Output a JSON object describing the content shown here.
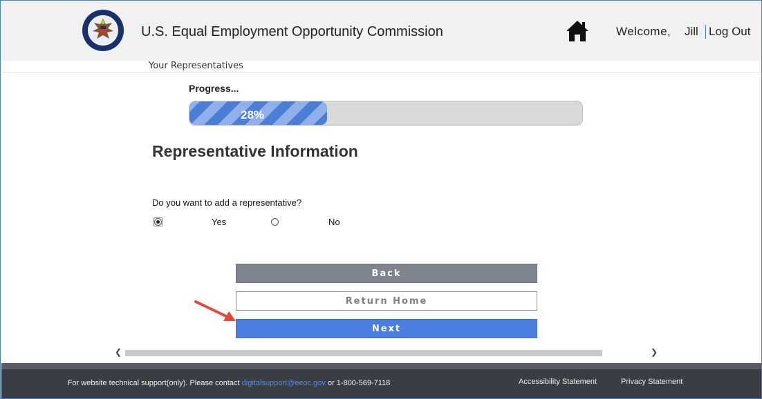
{
  "header": {
    "site_title": "U.S. Equal Employment Opportunity Commission",
    "welcome": "Welcome,",
    "user_name": "Jill",
    "logout": "Log Out"
  },
  "breadcrumb": "Your Representatives",
  "progress": {
    "label": "Progress...",
    "percent_text": "28%",
    "fraction": 0.28
  },
  "section": {
    "heading": "Representative Information",
    "question": "Do you want to add a representative?",
    "options": [
      {
        "label": "Yes",
        "checked": true
      },
      {
        "label": "No",
        "checked": false
      }
    ]
  },
  "buttons": {
    "back": "Back",
    "return_home": "Return Home",
    "next": "Next"
  },
  "footer": {
    "support_prefix": "For website technical support(only). Please contact",
    "support_email": "digitalsupport@eeoc.gov",
    "support_suffix": "or 1-800-569-7118",
    "accessibility": "Accessibility Statement",
    "privacy": "Privacy Statement"
  },
  "colors": {
    "accent": "#4a7fe0",
    "annotation_arrow": "#e8473a"
  }
}
